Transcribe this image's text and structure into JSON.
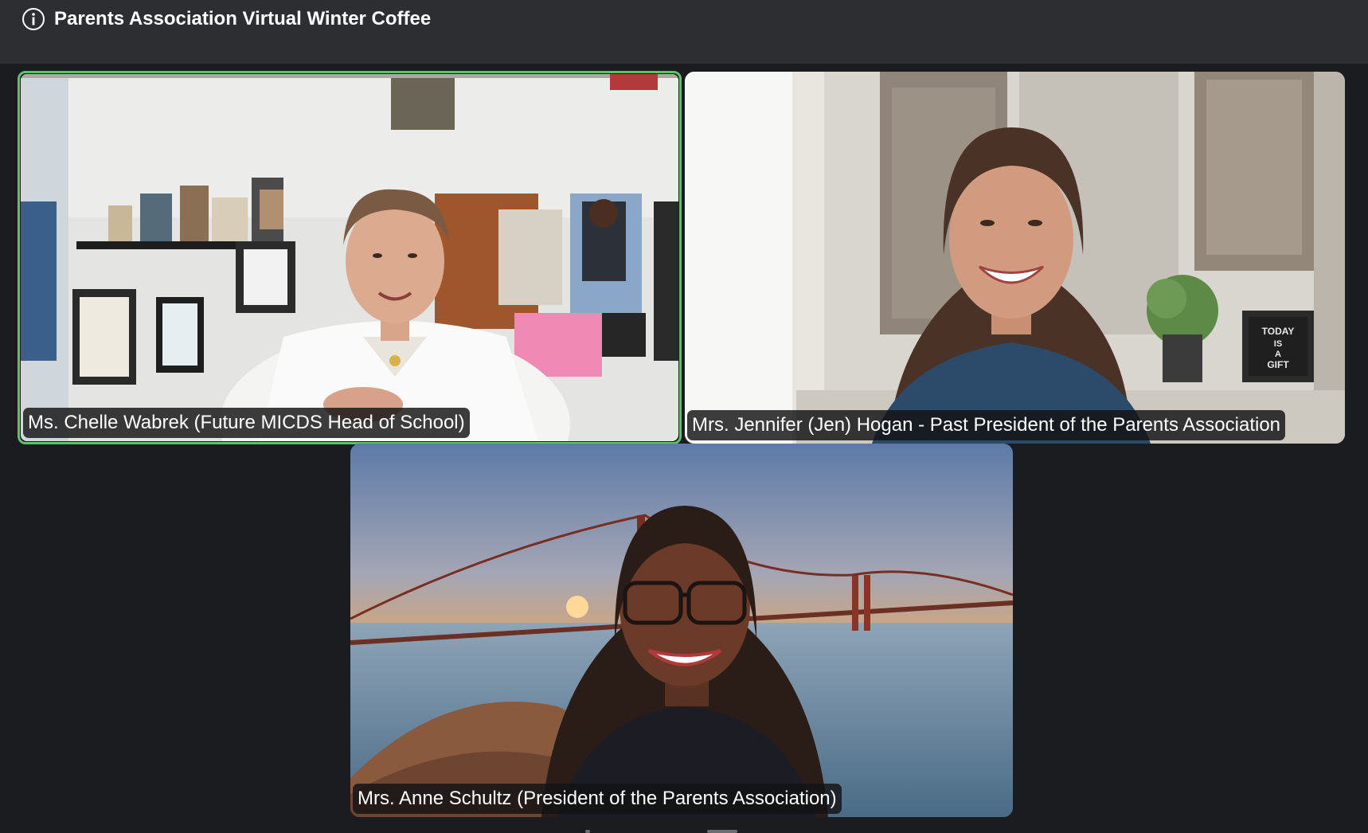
{
  "header": {
    "meeting_title": "Parents Association Virtual Winter Coffee",
    "info_icon": "info-icon"
  },
  "participants": [
    {
      "name": "Ms. Chelle Wabrek (Future MICDS Head of School)",
      "active_speaker": true
    },
    {
      "name": "Mrs. Jennifer (Jen) Hogan - Past President of the Parents Association",
      "active_speaker": false
    },
    {
      "name": "Mrs. Anne Schultz (President of the Parents Association)",
      "active_speaker": false
    }
  ],
  "colors": {
    "background": "#1a1c1f",
    "titlebar": "#2c2e31",
    "active_speaker_border": "#5ec26a"
  }
}
